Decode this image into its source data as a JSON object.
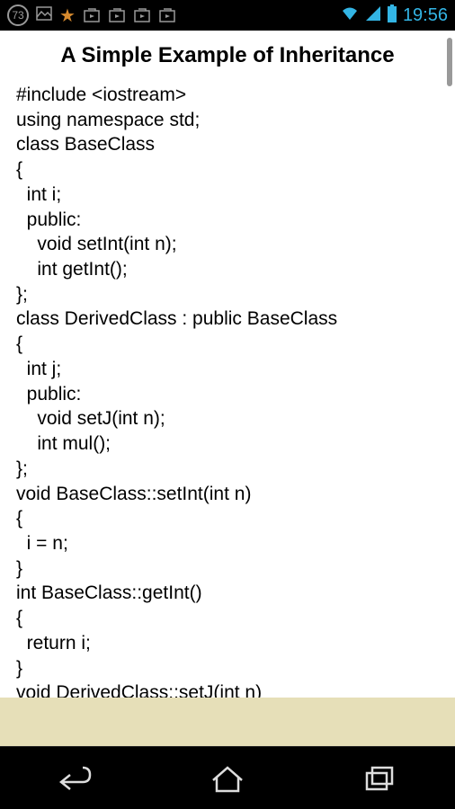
{
  "statusBar": {
    "badge": "73",
    "time": "19:56"
  },
  "page": {
    "title": "A Simple Example of Inheritance",
    "code": "#include <iostream>\nusing namespace std;\nclass BaseClass\n{\n  int i;\n  public:\n    void setInt(int n);\n    int getInt();\n};\nclass DerivedClass : public BaseClass\n{\n  int j;\n  public:\n    void setJ(int n);\n    int mul();\n};\nvoid BaseClass::setInt(int n)\n{\n  i = n;\n}\nint BaseClass::getInt()\n{\n  return i;\n}\nvoid DerivedClass::setJ(int n)"
  }
}
